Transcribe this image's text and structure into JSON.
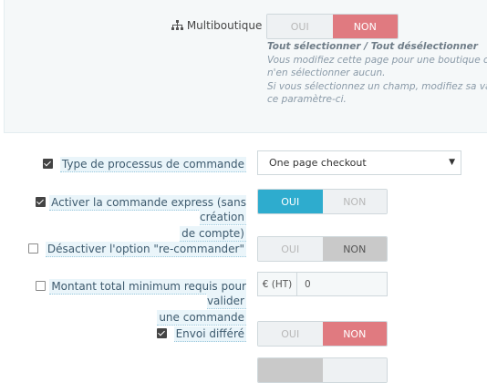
{
  "multiboutique": {
    "label": "Multiboutique",
    "oui": "OUI",
    "non": "NON",
    "help_title": "Tout sélectionner / Tout désélectionner",
    "help_line1": "Vous modifiez cette page pour une boutique ou",
    "help_line2": "n'en sélectionner aucun.",
    "help_line3": "Si vous sélectionnez un champ, modifiez sa vale",
    "help_line4": "ce paramètre-ci."
  },
  "fields": {
    "process_type": {
      "label": "Type de processus de commande",
      "value": "One page checkout"
    },
    "express": {
      "label_line1": "Activer la commande express (sans création",
      "label_line2": "de compte)",
      "oui": "OUI",
      "non": "NON"
    },
    "reorder": {
      "label": "Désactiver l'option \"re-commander\"",
      "oui": "OUI",
      "non": "NON"
    },
    "min_total": {
      "label_line1": "Montant total minimum requis pour valider",
      "label_line2": "une commande",
      "addon": "€ (HT)",
      "value": "0"
    },
    "deferred": {
      "label": "Envoi différé",
      "oui": "OUI",
      "non": "NON"
    }
  },
  "colors": {
    "accent_on": "#2eacce",
    "accent_off": "#e07a80",
    "gray_selected": "#c9c9c9"
  }
}
